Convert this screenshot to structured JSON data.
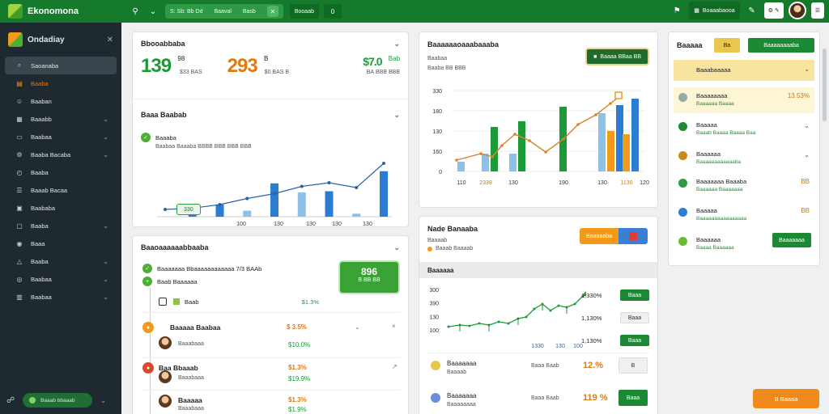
{
  "topbar": {
    "app_name": "Ekonomona",
    "pill_text_1": "S: Sb: Bb Dd",
    "pill_text_2": "Baaval",
    "pill_text_3": "Basb",
    "btn_1": "Booaab",
    "btn_2": "0",
    "right_btn": "Boaaabaooa",
    "white_btn": "Bbna\nBbba"
  },
  "sidebar": {
    "title": "Ondadiay",
    "items": [
      {
        "label": "Saoanaba",
        "icon": "search-icon",
        "chev": ""
      },
      {
        "label": "Baaba",
        "icon": "folder-icon",
        "chev": ""
      },
      {
        "label": "Baaban",
        "icon": "user-icon",
        "chev": ""
      },
      {
        "label": "Baaabb",
        "icon": "grid-icon",
        "chev": "⌄"
      },
      {
        "label": "Baabaa",
        "icon": "monitor-icon",
        "chev": "⌄"
      },
      {
        "label": "Baaba Bacaba",
        "icon": "gear-icon",
        "chev": "⌄"
      },
      {
        "label": "Baaba",
        "icon": "clock-icon",
        "chev": ""
      },
      {
        "label": "Baaab Bacaa",
        "icon": "list-icon",
        "chev": ""
      },
      {
        "label": "Baababa",
        "icon": "calendar-icon",
        "chev": ""
      },
      {
        "label": "Baaba",
        "icon": "box-icon",
        "chev": "⌄"
      },
      {
        "label": "Baaa",
        "icon": "chat-icon",
        "chev": ""
      },
      {
        "label": "Baaba",
        "icon": "triangle-icon",
        "chev": "⌄"
      },
      {
        "label": "Baabaa",
        "icon": "globe-icon",
        "chev": "⌄"
      },
      {
        "label": "Baabaa",
        "icon": "archive-icon",
        "chev": "⌄"
      }
    ],
    "footer_text": "Baaab bbaaab"
  },
  "overview": {
    "title": "Bbooabbaba",
    "kpis": [
      {
        "value": "139",
        "side": "98",
        "sub": "$33 BAS"
      },
      {
        "value": "293",
        "side": "B",
        "sub": "$0 BAS B"
      },
      {
        "value": "$7.0",
        "side": "Bab",
        "sub": "BA BBB BBB"
      }
    ]
  },
  "trend": {
    "title": "Baaa Baabab",
    "legend_title": "Baaaba",
    "legend_sub": "Baabaa Baaaba BBBB BBB BBB BBB",
    "x_ticks": [
      "330",
      "100",
      "130",
      "130",
      "130",
      "130"
    ]
  },
  "activity": {
    "title": "Baaoaaaaaabbaaba",
    "legend_1": "Baaaaaaa Bbaaaaaaaaaaaa 7/3 BAAb",
    "legend_2": "Baab Baaaaaa",
    "big_btn_value": "896",
    "big_btn_sub": "B BB BB",
    "rows": [
      {
        "title": "Baab",
        "value": "$1.3%",
        "sub": ""
      },
      {
        "title": "Baaaaa Baabaa",
        "value": "$ 3.5%",
        "sub": "$10.0%",
        "sub_label": "Baaabaaa"
      },
      {
        "title": "Baa Bbaaab",
        "value": "$1,3%",
        "sub": "$19.9%",
        "sub_label": "Baaabaaa"
      },
      {
        "title": "Baaaaa",
        "value": "$1.3%",
        "sub": "$1.9%",
        "sub_label": "Baaabaaa"
      }
    ]
  },
  "comparison": {
    "title": "Baaaaaaoaaabaaaba",
    "sub_1": "Baabaa",
    "sub_2": "Baaba BB BBB",
    "btn": "Baaaa BBaa BB",
    "y_ticks": [
      "330",
      "180",
      "130",
      "160",
      "0"
    ],
    "x_ticks": [
      "110",
      "2339",
      "130",
      "190",
      "130",
      "1130",
      "120"
    ]
  },
  "nodes": {
    "title": "Nade Banaaba",
    "sub_1": "Baaaab",
    "sub_2": "Baaab Baaaab",
    "btn_orange": "Baaaaaba",
    "section": "Baaaaaa",
    "y_ticks": [
      "300",
      "390",
      "130",
      "100"
    ],
    "x_ticks": [
      "1330",
      "130",
      "100"
    ],
    "table": [
      {
        "value": "1,330%",
        "btn": "Baaa",
        "btn_style": "green"
      },
      {
        "value": "1,130%",
        "btn": "Baaa",
        "btn_style": "grey"
      },
      {
        "value": "1,130%",
        "btn": "Baaa",
        "btn_style": "green"
      }
    ],
    "bottom": [
      {
        "title": "Baaaaaaa",
        "sub": "Baaaab",
        "mid": "Baaa Baab",
        "value": "12.%",
        "btn": "B",
        "btn_style": "grey"
      },
      {
        "title": "Baaaaaaa",
        "sub": "Baaaaaaaa",
        "mid": "Baaa Baab",
        "value": "119 %",
        "btn": "Baaa",
        "btn_style": "green"
      }
    ]
  },
  "right_panel": {
    "title": "Baaaaa",
    "btn_yellow": "Ba",
    "btn_green": "Baaaaaaaaba",
    "items": [
      {
        "title": "Baaabaaaaa",
        "sub": "",
        "value": "",
        "highlight": "yellow"
      },
      {
        "title": "Baaaaaaaa",
        "sub": "Baaaaaa Baaaa",
        "value": "13.53%",
        "highlight": "lightyellow"
      },
      {
        "title": "Baaaaa",
        "sub": "Baaab Baaaa Baaaa Baa",
        "value": "",
        "highlight": ""
      },
      {
        "title": "Baaaaaa",
        "sub": "Baaaaaaaaaaaaba",
        "value": "",
        "highlight": ""
      },
      {
        "title": "Baaaaaaa Baaaba",
        "sub": "Baaaaaa Baaaaaaa",
        "value": "BB",
        "highlight": ""
      },
      {
        "title": "Baaaaa",
        "sub": "Baaaaaaaaaaaaaaaa",
        "value": "BB",
        "highlight": ""
      },
      {
        "title": "Baaaaaa",
        "sub": "Baaaa Baaaaaa",
        "value": "",
        "btn": "Baaaaaaa",
        "highlight": ""
      }
    ]
  },
  "float_btn": "B Baaaa",
  "colors": {
    "brand": "#167a2c",
    "accent": "#f29a1a",
    "blue": "#2a7dd1",
    "lightblue": "#8cc2ea"
  }
}
